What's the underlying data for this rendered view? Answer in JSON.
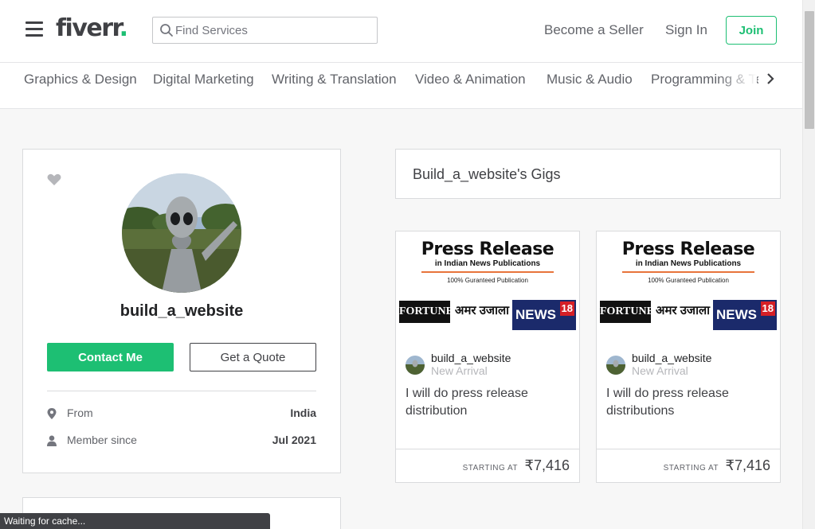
{
  "header": {
    "logo_text": "fiverr",
    "logo_dot": ".",
    "search_placeholder": "Find Services",
    "become_seller": "Become a Seller",
    "sign_in": "Sign In",
    "join": "Join",
    "brand_color": "#1dbf73"
  },
  "categories": [
    "Graphics & Design",
    "Digital Marketing",
    "Writing & Translation",
    "Video & Animation",
    "Music & Audio",
    "Programming & Tech"
  ],
  "profile": {
    "username": "build_a_website",
    "contact_button": "Contact Me",
    "quote_button": "Get a Quote",
    "from_label": "From",
    "from_value": "India",
    "member_label": "Member since",
    "member_value": "Jul 2021"
  },
  "gigs": {
    "header": "Build_a_website's Gigs",
    "items": [
      {
        "image": {
          "title": "Press Release",
          "subtitle": "in Indian News Publications",
          "guarantee": "100% Guranteed Publication",
          "logo1": "FORTUNE",
          "logo2": "अमर उजाला",
          "logo3": "NEWS",
          "logo3_badge": "18"
        },
        "seller": "build_a_website",
        "level": "New Arrival",
        "title": "I will do press release distribution",
        "starting_label": "STARTING AT",
        "price": "₹7,416"
      },
      {
        "image": {
          "title": "Press Release",
          "subtitle": "in Indian News Publications",
          "guarantee": "100% Guranteed Publication",
          "logo1": "FORTUNE",
          "logo2": "अमर उजाला",
          "logo3": "NEWS",
          "logo3_badge": "18"
        },
        "seller": "build_a_website",
        "level": "New Arrival",
        "title": "I will do press release distributions",
        "starting_label": "STARTING AT",
        "price": "₹7,416"
      }
    ]
  },
  "status_bar": "Waiting for cache..."
}
